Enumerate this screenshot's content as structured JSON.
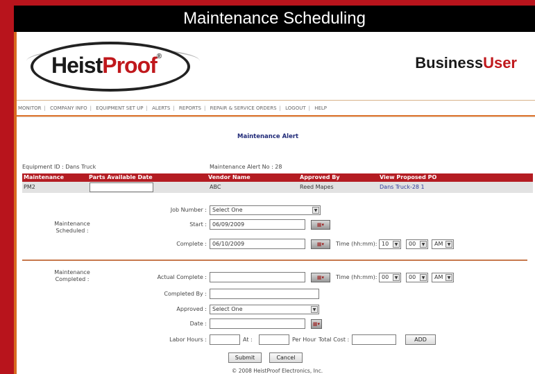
{
  "banner_title": "Maintenance Scheduling",
  "logo": {
    "heist": "Heist",
    "proof": "Proof",
    "reg": "®"
  },
  "business_user": {
    "part1": "Business",
    "part2": "User"
  },
  "nav": [
    "MONITOR",
    "COMPANY INFO",
    "EQUIPMENT SET UP",
    "ALERTS",
    "REPORTS",
    "REPAIR & SERVICE ORDERS",
    "LOGOUT",
    "HELP"
  ],
  "alert_title": "Maintenance Alert",
  "equipment_id": "Equipment ID : Dans Truck",
  "alert_no": "Maintenance Alert No : 28",
  "table": {
    "headers": [
      "Maintenance",
      "Parts Available Date",
      "Vendor Name",
      "Approved By",
      "View Proposed PO"
    ],
    "row": {
      "maintenance": "PM2",
      "parts_date": "",
      "vendor": "ABC",
      "approved_by": "Reed Mapes",
      "po_link": "Dans Truck-28 1"
    }
  },
  "scheduled": {
    "section_label": "Maintenance Scheduled :",
    "job_number_label": "Job Number :",
    "job_number_value": "Select One",
    "start_label": "Start :",
    "start_value": "06/09/2009",
    "complete_label": "Complete :",
    "complete_value": "06/10/2009",
    "time_label": "Time (hh:mm):",
    "hour": "10",
    "minute": "00",
    "ampm": "AM"
  },
  "completed": {
    "section_label": "Maintenance Completed :",
    "actual_complete_label": "Actual Complete :",
    "actual_complete_value": "",
    "time_label": "Time (hh:mm):",
    "hour": "00",
    "minute": "00",
    "ampm": "AM",
    "completed_by_label": "Completed By :",
    "approved_label": "Approved :",
    "approved_value": "Select One",
    "date_label": "Date :",
    "labor_hours_label": "Labor Hours :",
    "at_label": "At :",
    "per_hour_label": "Per Hour",
    "total_cost_label": "Total Cost :",
    "add_label": "ADD"
  },
  "buttons": {
    "submit": "Submit",
    "cancel": "Cancel"
  },
  "copyright": "© 2008 HeistProof Electronics, Inc.",
  "calendar_icon_glyph": "▦▾",
  "select_arrow_glyph": "▼"
}
